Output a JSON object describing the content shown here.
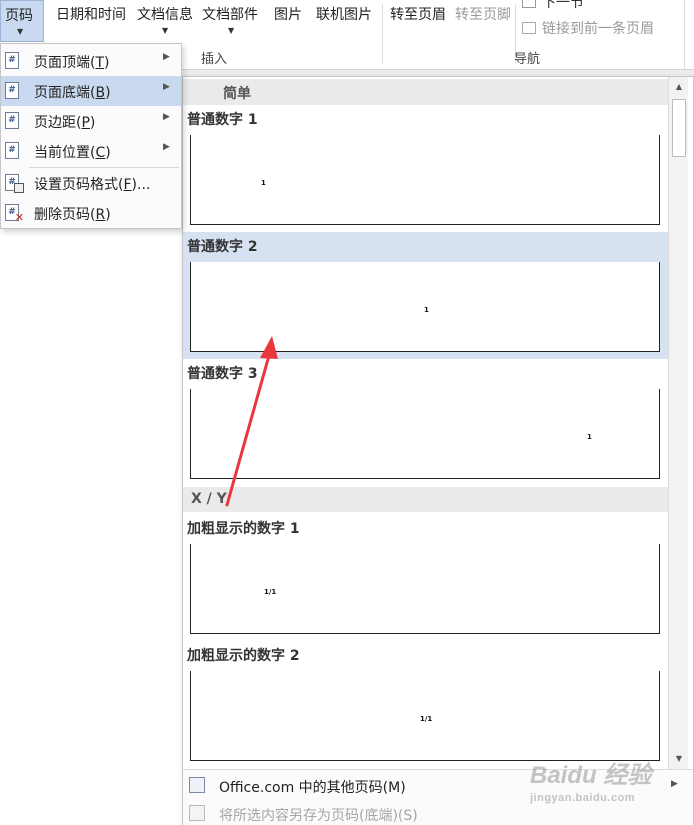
{
  "ribbon": {
    "page_number": "页码",
    "date_time": "日期和时间",
    "doc_info": "文档信息",
    "doc_parts": "文档部件",
    "picture": "图片",
    "online_picture": "联机图片",
    "goto_header": "转至页眉",
    "goto_footer": "转至页脚",
    "next_section": "下一节",
    "link_previous": "链接到前一条页眉",
    "group_insert": "插入",
    "group_nav": "导航"
  },
  "menu": {
    "items": [
      {
        "label": "页面顶端(",
        "key": "T",
        "suffix": ")"
      },
      {
        "label": "页面底端(",
        "key": "B",
        "suffix": ")"
      },
      {
        "label": "页边距(",
        "key": "P",
        "suffix": ")"
      },
      {
        "label": "当前位置(",
        "key": "C",
        "suffix": ")"
      },
      {
        "label": "设置页码格式(",
        "key": "F",
        "suffix": ")..."
      },
      {
        "label": "删除页码(",
        "key": "R",
        "suffix": ")"
      }
    ]
  },
  "gallery": {
    "section_simple": "简单",
    "section_xy": "X / Y",
    "items": [
      {
        "title": "普通数字 1",
        "preview": "1",
        "align": "left"
      },
      {
        "title": "普通数字 2",
        "preview": "1",
        "align": "center"
      },
      {
        "title": "普通数字 3",
        "preview": "1",
        "align": "right"
      },
      {
        "title": "加粗显示的数字 1",
        "preview": "1/1",
        "align": "left"
      },
      {
        "title": "加粗显示的数字 2",
        "preview": "1/1",
        "align": "center"
      }
    ],
    "footer": {
      "more": "Office.com 中的其他页码(M)",
      "save_selection": "将所选内容另存为页码(底端)(S)"
    }
  },
  "watermark": {
    "brand": "Baidu 经验",
    "url": "jingyan.baidu.com"
  },
  "colors": {
    "highlight": "#c9daf0",
    "selected_item": "#d6e1f2",
    "annotation_arrow": "#e8383d"
  }
}
